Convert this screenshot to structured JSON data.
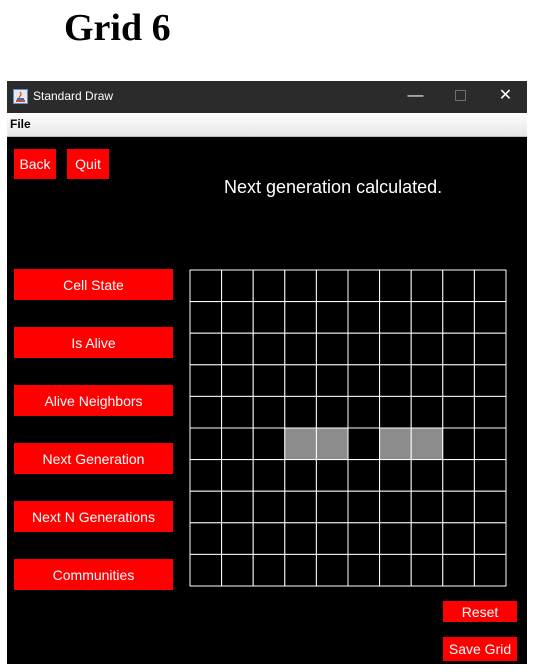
{
  "heading": "Grid 6",
  "window": {
    "title": "Standard Draw",
    "minimize_glyph": "—",
    "close_glyph": "✕"
  },
  "menu": {
    "file": "File"
  },
  "top_buttons": {
    "back": "Back",
    "quit": "Quit"
  },
  "status": "Next generation calculated.",
  "actions": {
    "cell_state": "Cell State",
    "is_alive": "Is Alive",
    "alive_neighbors": "Alive Neighbors",
    "next_generation": "Next Generation",
    "next_n_generations": "Next N Generations",
    "communities": "Communities"
  },
  "bottom_buttons": {
    "reset": "Reset",
    "save_grid": "Save Grid"
  },
  "grid": {
    "rows": 10,
    "cols": 10,
    "alive_cells": [
      [
        5,
        3
      ],
      [
        5,
        4
      ],
      [
        5,
        6
      ],
      [
        5,
        7
      ]
    ]
  },
  "colors": {
    "button": "#ff0000",
    "background": "#000000",
    "grid_line": "#ffffff",
    "alive_cell": "#8c8c8c"
  }
}
